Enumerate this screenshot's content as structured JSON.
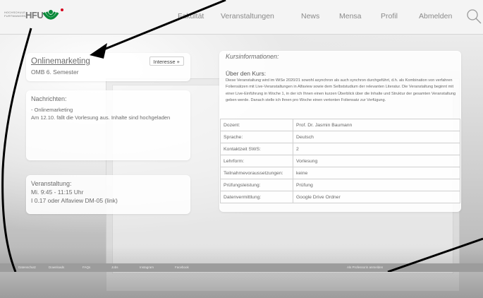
{
  "header": {
    "logo": {
      "small_text": "HOCHSCHULE FURTWANGEN",
      "brand": "HFU"
    },
    "nav": [
      "Fakultät",
      "Veranstaltungen",
      "News",
      "Mensa",
      "Profil",
      "Abmelden"
    ],
    "search_icon": "search-icon",
    "colors": {
      "brand_green": "#0a8a3a",
      "brand_red": "#d6001c"
    }
  },
  "course": {
    "title": "Onlinemarketing",
    "semester": "OMB 6. Semester",
    "interest_button": "Interesse +"
  },
  "messages": {
    "heading": "Nachrichten:",
    "item_title": "- Onlinemarketing",
    "item_text": "Am 12.10. fällt die Vorlesung aus. Inhalte sind hochgeladen"
  },
  "event": {
    "heading": "Veranstaltung:",
    "time": "Mi. 9:45 - 11:15 Uhr",
    "room": "I 0.17 oder Alfaview DM-05 (link)"
  },
  "info": {
    "title": "Kursinformationen:",
    "desc_heading": "Über den Kurs:",
    "desc_text": "Diese Veranstaltung wird im WiSe 2020/21 sowohl asynchron als auch synchron durchgeführt, d.h. als Kombination von verfahren Foliensätzen mit Live-Veranstaltungen in Alfaview sowie dem Selbststudium der relevanten Literatur. Die Veranstaltung beginnt mit einer Live-Einführung in Woche 1, in der ich Ihnen einen kurzen Überblick über die Inhalte und Struktur der gesamten Veranstaltung geben werde. Danach stelle ich Ihnen pro Woche einen vertonten Foliensatz zur Verfügung.",
    "rows": [
      [
        "Dozent:",
        "Prof. Dr. Jasmin Baumann"
      ],
      [
        "Sprache:",
        "Deutsch"
      ],
      [
        "Kontaktzeit SWS:",
        "2"
      ],
      [
        "Lehrform:",
        "Vorlesung"
      ],
      [
        "Teilnahmevoraussetzungen:",
        "keine"
      ],
      [
        "Prüfungsleistung:",
        "Prüfung"
      ],
      [
        "Datenvermittlung:",
        "Google Drive Ordner"
      ]
    ]
  },
  "footer": {
    "links": [
      "Datenschutz",
      "Downloads",
      "FAQs",
      "Jobs",
      "Instagram",
      "Facebook"
    ],
    "right_text": "Als Professorin anmelden"
  }
}
